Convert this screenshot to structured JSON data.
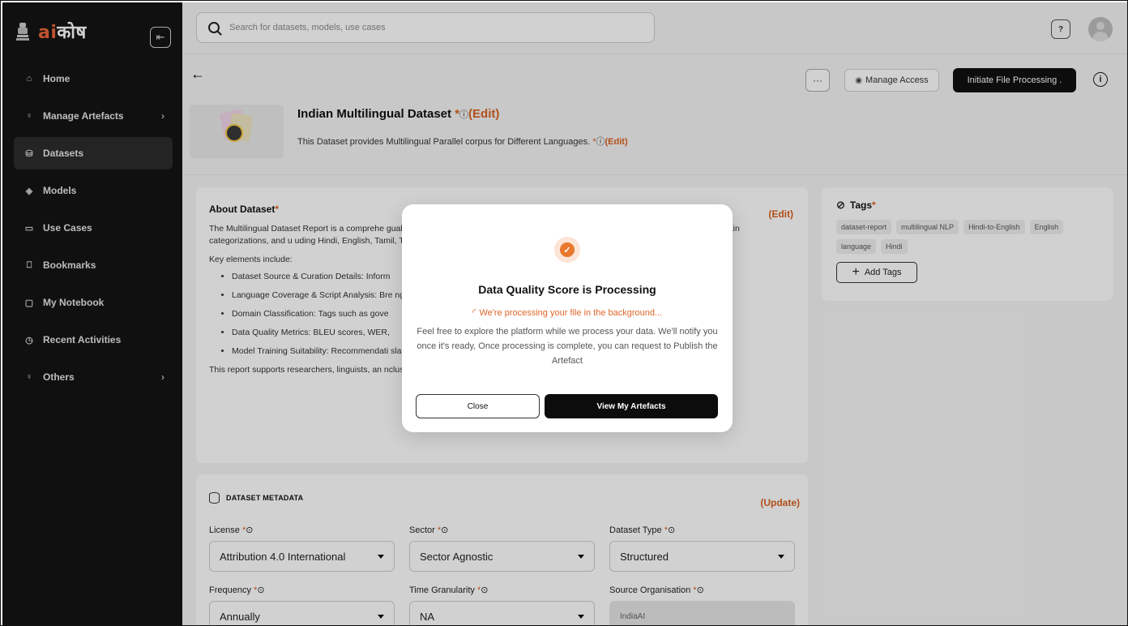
{
  "sidebar": {
    "logo_ai": "ai",
    "logo_kosh": "कोष",
    "items": [
      {
        "label": "Home",
        "icon": "home-icon"
      },
      {
        "label": "Manage Artefacts",
        "icon": "bulb-icon"
      },
      {
        "label": "Datasets",
        "icon": "database-icon"
      },
      {
        "label": "Models",
        "icon": "cube-icon"
      },
      {
        "label": "Use Cases",
        "icon": "briefcase-icon"
      },
      {
        "label": "Bookmarks",
        "icon": "bookmark-icon"
      },
      {
        "label": "My Notebook",
        "icon": "notebook-icon"
      },
      {
        "label": "Recent Activities",
        "icon": "clock-icon"
      },
      {
        "label": "Others",
        "icon": "bulb-icon"
      }
    ]
  },
  "search": {
    "placeholder": "Search for datasets, models, use cases"
  },
  "actions": {
    "more": "···",
    "manage_access": "Manage Access",
    "initiate": "Initiate File Processing ."
  },
  "dataset": {
    "title": "Indian Multilingual Dataset",
    "description": "This Dataset provides Multilingual Parallel corpus for Different Languages.",
    "required_mark": "*",
    "edit": "(Edit)"
  },
  "about": {
    "heading": "About Dataset",
    "edit": "(Edit)",
    "intro": "The Multilingual Dataset Report is a comprehe                                                                                      gual datasets, with a primary focus on linguistic diversity acr                                                                                    res, token-level statistics, domain categorizations, and u                                                                                       uding Hindi, English, Tamil, Telugu, Bengali, Marathi, and o",
    "key_heading": "Key elements include:",
    "bullets": [
      "Dataset Source & Curation Details: Inform",
      "Language Coverage & Script Analysis: Bre                                                                               ngs.",
      "Domain Classification: Tags such as gove",
      "Data Quality Metrics: BLEU scores, WER,",
      "Model Training Suitability: Recommendati                                                                               slation (MT), and Language Modeling (LM) systems."
    ],
    "closing": "This report supports researchers, linguists, an                                                                                  nclusive and culturally aware language AI solutions."
  },
  "tags": {
    "heading": "Tags",
    "items": [
      "dataset-report",
      "multilingual NLP",
      "Hindi-to-English",
      "English",
      "language",
      "Hindi"
    ],
    "add": "Add Tags"
  },
  "metadata": {
    "heading": "DATASET METADATA",
    "update": "(Update)",
    "fields": {
      "license": {
        "label": "License",
        "value": "Attribution 4.0 International"
      },
      "sector": {
        "label": "Sector",
        "value": "Sector Agnostic"
      },
      "dataset_type": {
        "label": "Dataset Type",
        "value": "Structured"
      },
      "frequency": {
        "label": "Frequency",
        "value": "Annually"
      },
      "time_granularity": {
        "label": "Time Granularity",
        "value": "NA"
      },
      "source_org": {
        "label": "Source Organisation",
        "value": "IndiaAI"
      }
    }
  },
  "modal": {
    "title": "Data Quality Score is Processing",
    "status": "We're processing your file in the background...",
    "body": "Feel free to explore the platform while we process your data. We'll notify you once it's ready, Once processing is complete, you can request to Publish the Artefact",
    "close": "Close",
    "view": "View My Artefacts"
  },
  "colors": {
    "accent": "#d9621f",
    "sidebar_bg": "#141414",
    "primary_btn": "#111111"
  }
}
